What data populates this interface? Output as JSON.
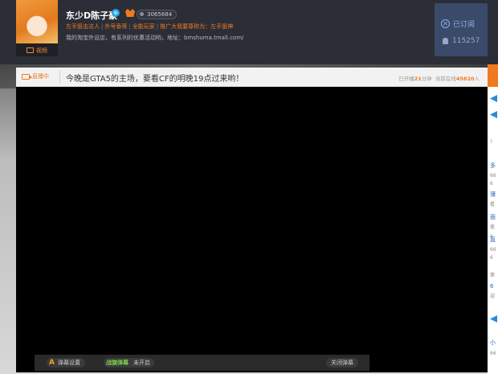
{
  "header": {
    "streamer_name": "东少D陈子豪",
    "room_id": "3065684",
    "tags": [
      "左手狙击达人",
      "外号香哥",
      "全能玩家",
      "推广大我要尊称为：左手狙神"
    ],
    "shop_line": "我的淘宝外设店，有系列的优惠活动哟，地址：bmshuma.tmall.com/",
    "video_tab_label": "视频",
    "subscribe_label": "已订阅",
    "subscriber_count": "115257"
  },
  "title_bar": {
    "live_label": "直播中",
    "room_title": "今晚是GTA5的主场，要看CF的明晚19点过来哟！",
    "stats": {
      "prefix": "已开播",
      "minutes": "21",
      "minutes_unit": "分钟",
      "online_prefix": "当前在线",
      "online": "45820",
      "online_unit": "人"
    }
  },
  "player": {
    "danmu_settings_icon": "A",
    "danmu_settings_label": "弹幕设置",
    "danmu_logo": "战旗弹幕",
    "danmu_toggle_state": "未开启",
    "close_danmu_label": "关闭弹幕"
  },
  "sidebar": {
    "fragments": [
      "?",
      "多",
      "66",
      "6",
      "薄",
      "看",
      "面",
      "鉴",
      "6",
      "直",
      "66",
      "6",
      "第",
      "6",
      "迎",
      "小",
      "66"
    ]
  },
  "colors": {
    "accent_orange": "#f07a20",
    "header_bg": "#2b2e36",
    "subscribe_panel": "#3a4a6a",
    "player_bg": "#000000"
  },
  "icons": {
    "video": "video-icon",
    "subscribed": "check-circle-icon",
    "user": "user-icon",
    "camera": "camera-icon",
    "verified": "verified-badge-icon",
    "crown": "crown-badge-icon"
  }
}
